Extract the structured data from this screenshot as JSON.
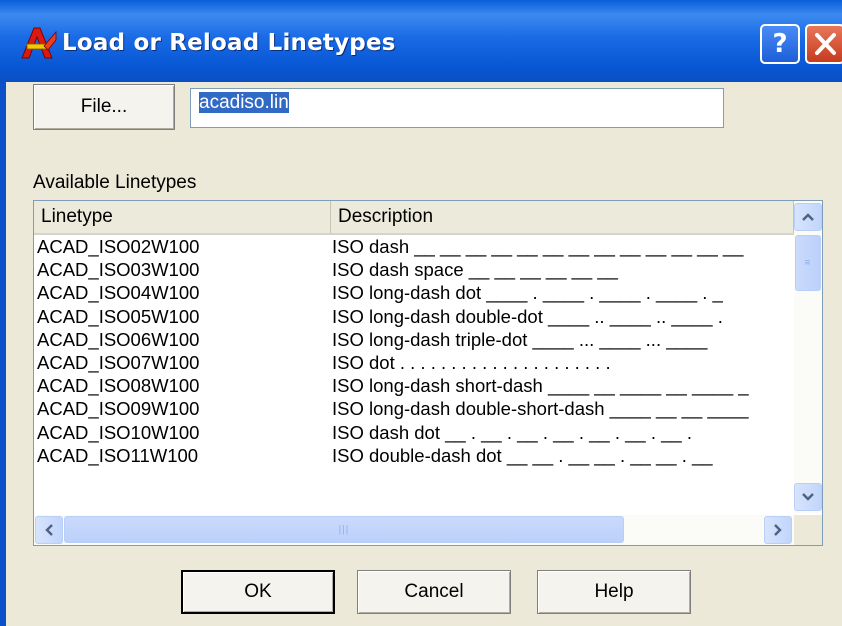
{
  "window": {
    "title": "Load or Reload Linetypes",
    "help_glyph": "?",
    "app_icon": "autocad-icon",
    "accent": "#0A5FD8",
    "close_color": "#C63B1D"
  },
  "file": {
    "button_label": "File...",
    "value": "acadiso.lin"
  },
  "list": {
    "label": "Available Linetypes",
    "columns": [
      "Linetype",
      "Description"
    ],
    "rows": [
      {
        "name": "ACAD_ISO02W100",
        "desc": "ISO dash __ __ __ __ __ __ __ __ __ __ __ __ __"
      },
      {
        "name": "ACAD_ISO03W100",
        "desc": "ISO dash space __    __    __    __    __    __"
      },
      {
        "name": "ACAD_ISO04W100",
        "desc": "ISO long-dash dot ____ . ____ . ____ . ____ . _"
      },
      {
        "name": "ACAD_ISO05W100",
        "desc": "ISO long-dash double-dot ____ .. ____ .. ____ ."
      },
      {
        "name": "ACAD_ISO06W100",
        "desc": "ISO long-dash triple-dot ____ ... ____ ... ____"
      },
      {
        "name": "ACAD_ISO07W100",
        "desc": "ISO dot . . . . . . . . . . . . . . . . . . . . ."
      },
      {
        "name": "ACAD_ISO08W100",
        "desc": "ISO long-dash short-dash ____ __ ____ __ ____ _"
      },
      {
        "name": "ACAD_ISO09W100",
        "desc": "ISO long-dash double-short-dash ____ __ __ ____"
      },
      {
        "name": "ACAD_ISO10W100",
        "desc": "ISO dash dot __ . __ . __ . __ . __ . __ . __ ."
      },
      {
        "name": "ACAD_ISO11W100",
        "desc": "ISO double-dash dot __ __ . __ __ . __ __ . __"
      }
    ]
  },
  "buttons": {
    "ok": "OK",
    "cancel": "Cancel",
    "help": "Help"
  }
}
